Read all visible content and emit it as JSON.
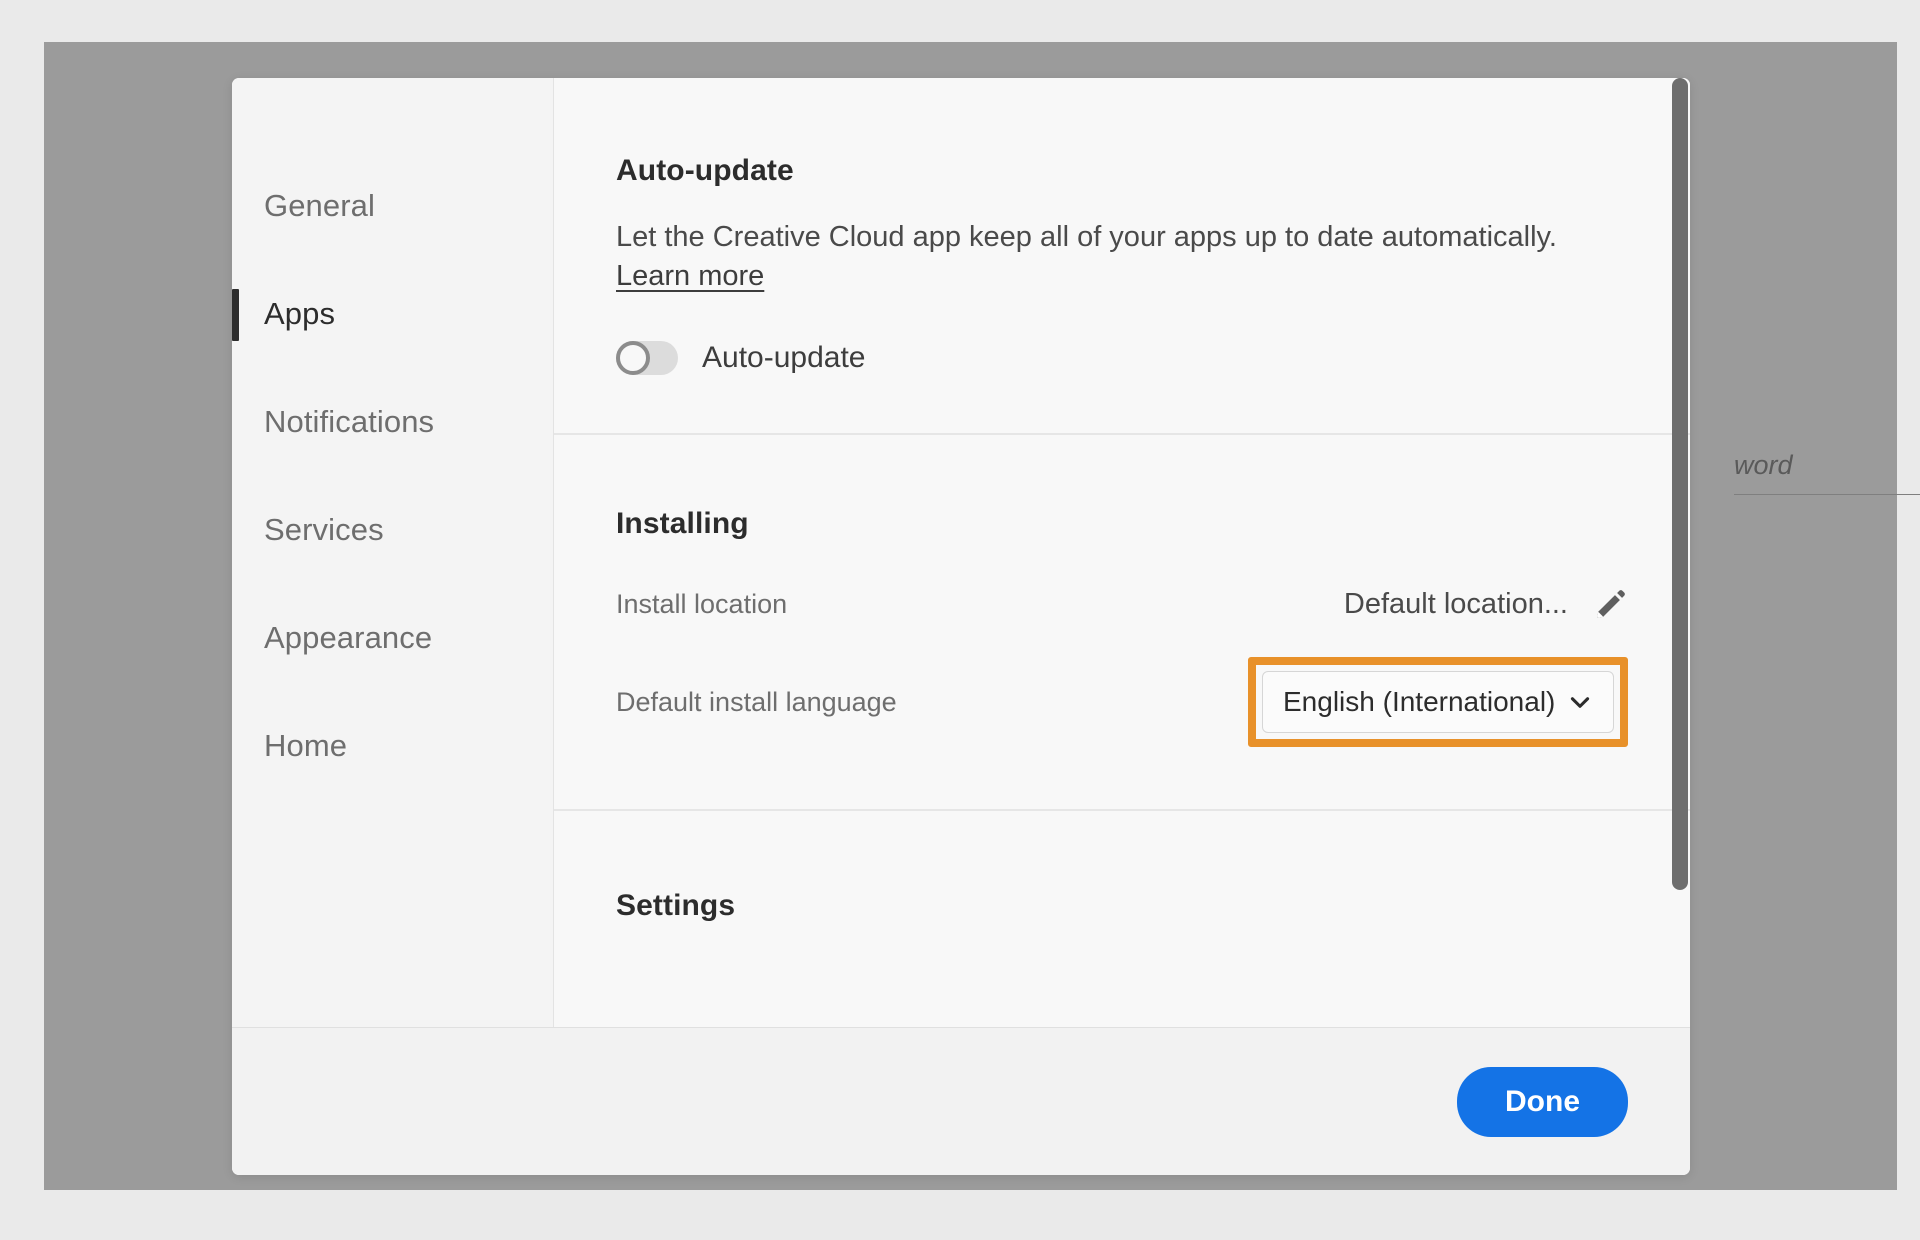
{
  "background": {
    "partial_text": "word"
  },
  "dialog": {
    "sidebar": {
      "items": [
        {
          "label": "General"
        },
        {
          "label": "Apps"
        },
        {
          "label": "Notifications"
        },
        {
          "label": "Services"
        },
        {
          "label": "Appearance"
        },
        {
          "label": "Home"
        }
      ]
    },
    "sections": {
      "auto_update": {
        "title": "Auto-update",
        "description": "Let the Creative Cloud app keep all of your apps up to date automatically.",
        "learn_more": "Learn more",
        "toggle_label": "Auto-update",
        "toggle_state": "off"
      },
      "installing": {
        "title": "Installing",
        "install_location_label": "Install location",
        "install_location_value": "Default location...",
        "edit_icon": "pencil-icon",
        "language_label": "Default install language",
        "language_value": "English (International)",
        "language_chevron": "chevron-down-icon"
      },
      "settings": {
        "title": "Settings"
      }
    },
    "footer": {
      "done_label": "Done"
    }
  },
  "colors": {
    "accent_blue": "#1473e6",
    "highlight_orange": "#e8912a",
    "overlay_gray": "#9b9b9b",
    "page_gray": "#eaeaea"
  }
}
